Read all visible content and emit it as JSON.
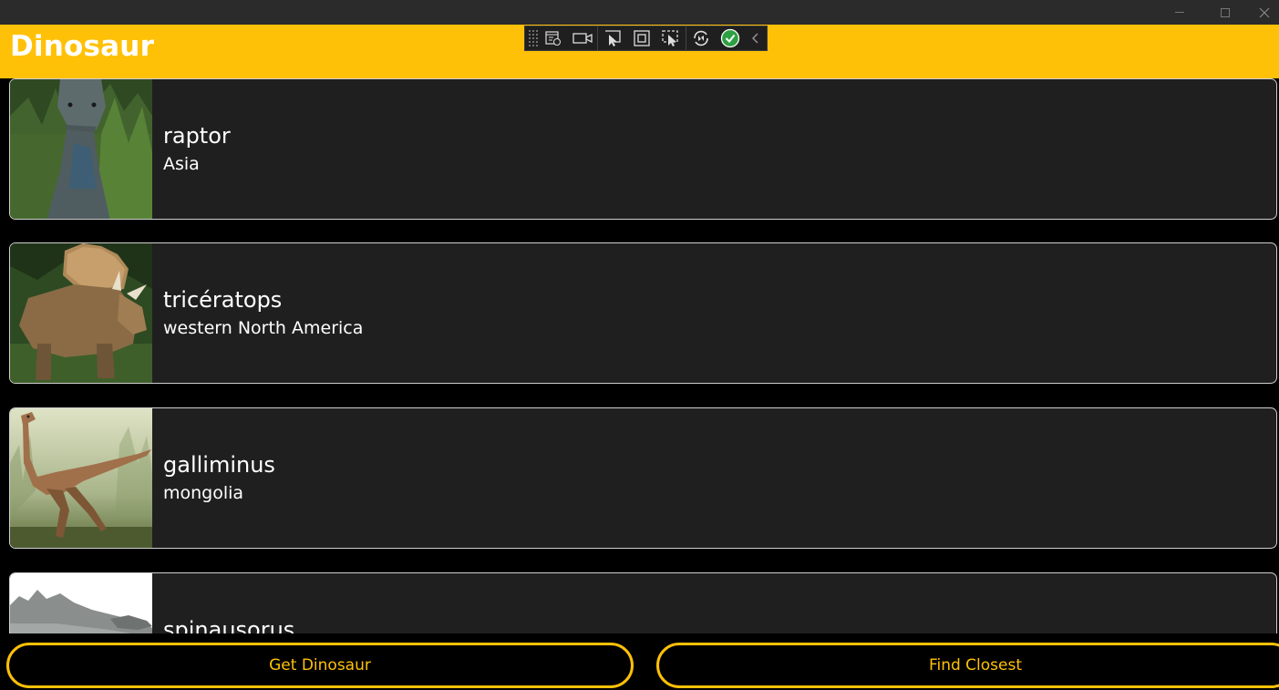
{
  "window": {
    "minimize_icon": "minimize-icon",
    "maximize_icon": "maximize-icon",
    "close_icon": "close-icon"
  },
  "header": {
    "title": "Dinosaur",
    "background_color": "#ffc107"
  },
  "dev_toolbar": {
    "tools": [
      "live-visual-tree-icon",
      "record-icon",
      "select-element-icon",
      "display-layout-adorners-icon",
      "track-focus-icon",
      "hot-reload-icon",
      "hot-reload-status-icon",
      "collapse-toolbar-icon"
    ]
  },
  "dinosaurs": [
    {
      "name": "raptor",
      "region": "Asia"
    },
    {
      "name": "tricératops",
      "region": "western North America"
    },
    {
      "name": "galliminus",
      "region": "mongolia"
    },
    {
      "name": "spinausorus",
      "region": ""
    }
  ],
  "actions": {
    "get_label": "Get Dinosaur",
    "closest_label": "Find Closest",
    "accent_color": "#ffc107"
  }
}
